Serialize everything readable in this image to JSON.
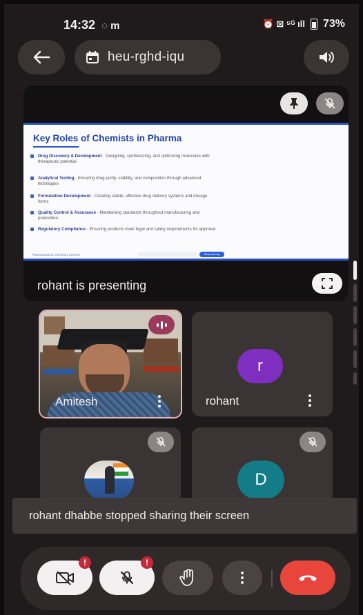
{
  "status_bar": {
    "time": "14:32",
    "time_icons": "◌ m",
    "right_icons": "⏰ ⊠ ⁵ᴳ ıll",
    "battery": "73%"
  },
  "top_bar": {
    "meeting_code": "heu-rghd-iqu"
  },
  "presentation": {
    "slide_title": "Key Roles of Chemists in Pharma",
    "bullets": [
      {
        "head": "Drug Discovery & Development",
        "text": " - Designing, synthesizing, and optimizing molecules with therapeutic potential"
      },
      {
        "head": "Analytical Testing",
        "text": " - Ensuring drug purity, stability, and composition through advanced techniques"
      },
      {
        "head": "Formulation Development",
        "text": " - Creating stable, effective drug delivery systems and dosage forms"
      },
      {
        "head": "Quality Control & Assurance",
        "text": " - Maintaining standards throughout manufacturing and production"
      },
      {
        "head": "Regulatory Compliance",
        "text": " - Ensuring products meet legal and safety requirements for approval"
      }
    ],
    "slide_footer": "Pharmaceutical Chemistry Careers",
    "slide_stop_label": "Stop sharing",
    "presenting_label": "rohant is presenting"
  },
  "participants": [
    {
      "name": "Amitesh"
    },
    {
      "name": "rohant",
      "initial": "r"
    },
    {
      "name": ""
    },
    {
      "name": "",
      "initial": "D"
    }
  ],
  "toast": {
    "message": "rohant dhabbe stopped sharing their screen"
  },
  "controls": {
    "camera_alert": "!",
    "mic_alert": "!"
  },
  "colors": {
    "background": "#1f1b1c",
    "surface": "#3b3435",
    "avatar_r": "#7f2fbf",
    "avatar_d": "#137c86",
    "end_call": "#e8453c",
    "slide_accent": "#2b53c4"
  }
}
